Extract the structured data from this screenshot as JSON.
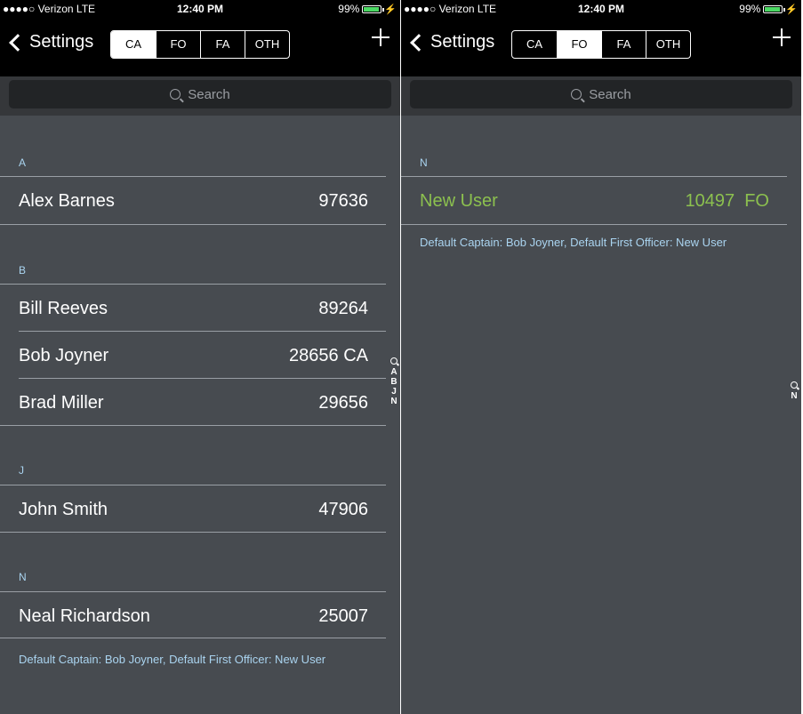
{
  "left": {
    "status": {
      "carrier": "●●●●○ Verizon  LTE",
      "time": "12:40 PM",
      "battery": "99%"
    },
    "nav": {
      "back_label": "Settings",
      "segments": [
        "CA",
        "FO",
        "FA",
        "OTH"
      ],
      "active_segment": "CA"
    },
    "search": {
      "placeholder": "Search"
    },
    "sections": [
      {
        "header": "A",
        "rows": [
          {
            "name": "Alex Barnes",
            "number": "97636",
            "role": ""
          }
        ]
      },
      {
        "header": "B",
        "rows": [
          {
            "name": "Bill Reeves",
            "number": "89264",
            "role": ""
          },
          {
            "name": "Bob Joyner",
            "number": "28656",
            "role": "CA"
          },
          {
            "name": "Brad Miller",
            "number": "29656",
            "role": ""
          }
        ]
      },
      {
        "header": "J",
        "rows": [
          {
            "name": "John Smith",
            "number": "47906",
            "role": ""
          }
        ]
      },
      {
        "header": "N",
        "rows": [
          {
            "name": "Neal Richardson",
            "number": "25007",
            "role": ""
          }
        ]
      }
    ],
    "footnote": "Default Captain: Bob Joyner, Default First Officer: New User",
    "index": [
      "A",
      "B",
      "J",
      "N"
    ]
  },
  "right": {
    "status": {
      "carrier": "●●●●○ Verizon  LTE",
      "time": "12:40 PM",
      "battery": "99%"
    },
    "nav": {
      "back_label": "Settings",
      "segments": [
        "CA",
        "FO",
        "FA",
        "OTH"
      ],
      "active_segment": "FO"
    },
    "search": {
      "placeholder": "Search"
    },
    "sections": [
      {
        "header": "N",
        "rows": [
          {
            "name": "New User",
            "number": "10497",
            "role": "FO"
          }
        ]
      }
    ],
    "footnote": "Default Captain: Bob Joyner, Default First Officer: New User",
    "index": [
      "N"
    ]
  },
  "colors": {
    "background": "#474b50",
    "bar": "#000000",
    "section_header": "#aad4f0",
    "highlight_user": "#8cc04f",
    "separator": "#9a9fa5"
  },
  "icons": {
    "back": "chevron-left-icon",
    "add": "plus-icon",
    "search": "search-icon",
    "battery": "battery-icon"
  }
}
